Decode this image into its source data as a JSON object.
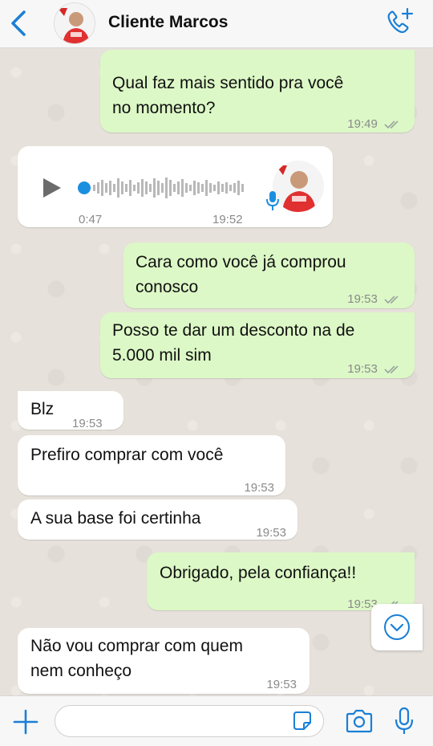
{
  "header": {
    "contact_name": "Cliente Marcos",
    "back_icon": "chevron-left-icon",
    "call_icon": "phone-plus-icon",
    "accent": "#1a7fd6"
  },
  "messages": [
    {
      "dir": "out",
      "lines": [
        "Qual faz mais sentido pra você",
        "no momento?"
      ],
      "time": "19:49",
      "read": true
    },
    {
      "dir": "in",
      "type": "audio",
      "duration": "0:47",
      "time": "19:52"
    },
    {
      "dir": "out",
      "lines": [
        "Cara como você já comprou",
        "conosco"
      ],
      "time": "19:53",
      "read": true
    },
    {
      "dir": "out",
      "lines": [
        "Posso te dar um desconto na de",
        "5.000 mil sim"
      ],
      "time": "19:53",
      "read": true
    },
    {
      "dir": "in",
      "lines": [
        "Blz"
      ],
      "time": "19:53"
    },
    {
      "dir": "in",
      "lines": [
        "Prefiro comprar com você"
      ],
      "time": "19:53"
    },
    {
      "dir": "in",
      "lines": [
        "A sua base foi certinha"
      ],
      "time": "19:53"
    },
    {
      "dir": "out",
      "lines": [
        "Obrigado, pela confiança!!"
      ],
      "time": "19:53",
      "read": true
    },
    {
      "dir": "in",
      "lines": [
        "Não vou comprar com quem",
        "nem conheço"
      ],
      "time": "19:53"
    }
  ],
  "composer": {
    "value": "",
    "placeholder": ""
  },
  "colors": {
    "outgoing_bubble": "#dcf8c6",
    "incoming_bubble": "#ffffff",
    "chat_bg": "#e6e1da",
    "accent_blue": "#1a7fd6"
  }
}
